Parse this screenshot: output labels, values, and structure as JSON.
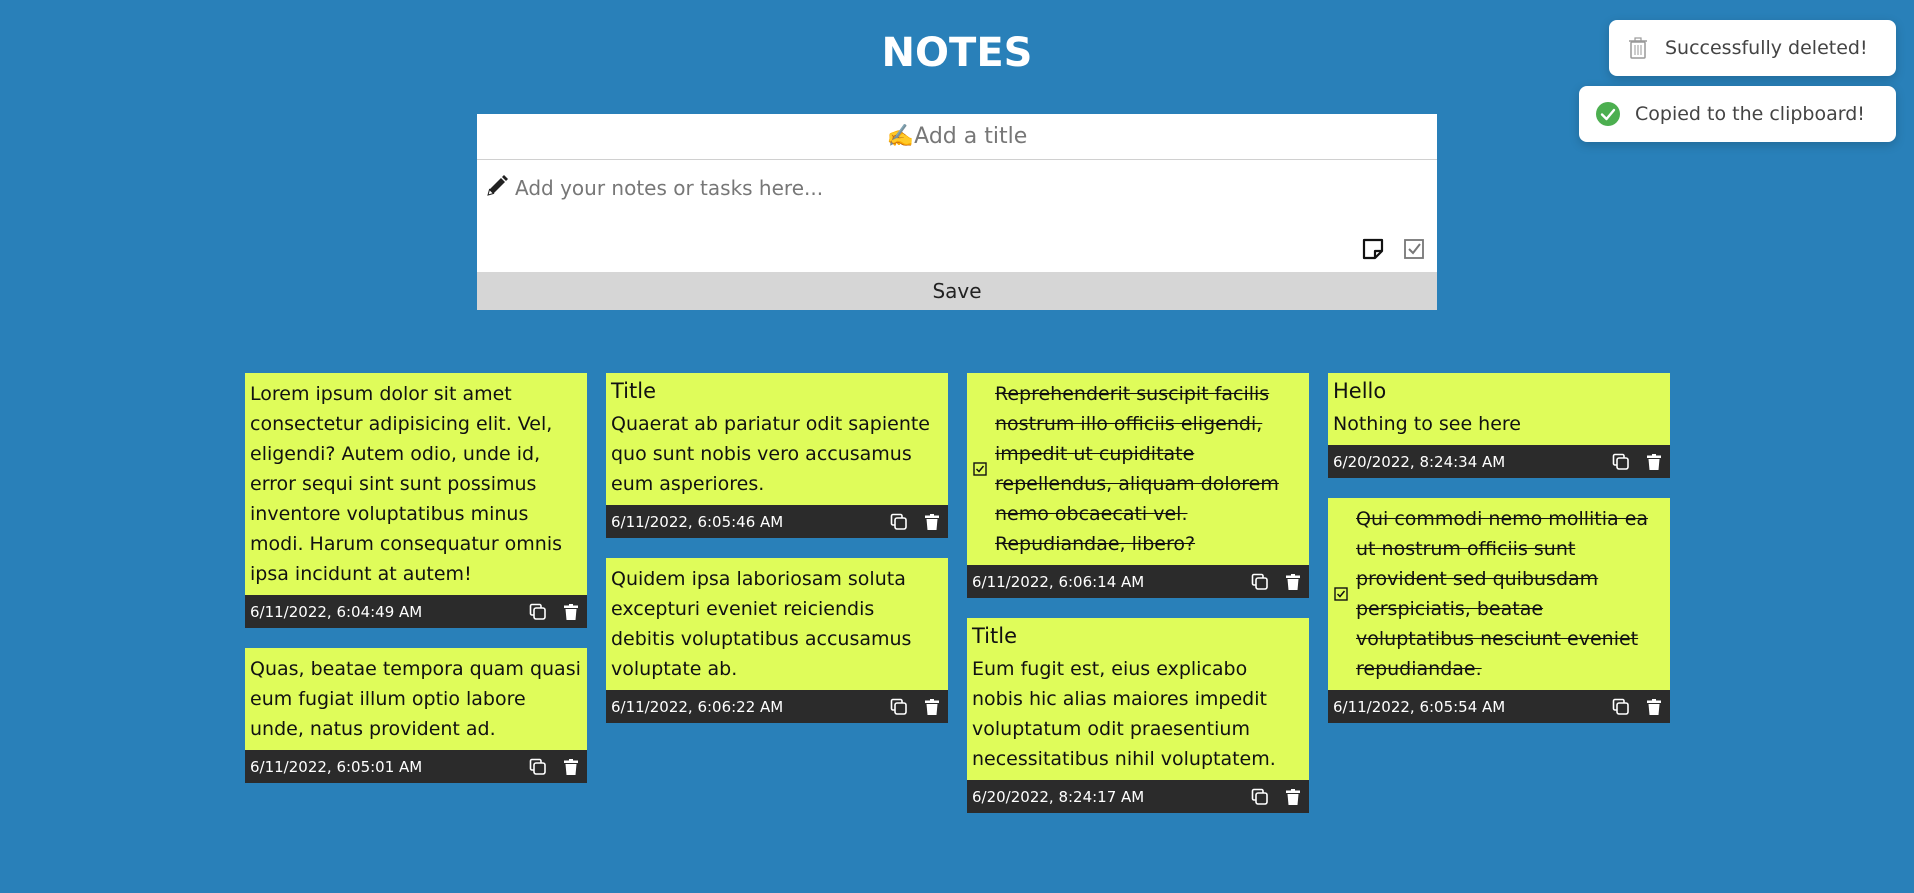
{
  "header": {
    "title": "NOTES"
  },
  "editor": {
    "title_placeholder": "✍️Add a title",
    "note_placeholder": "Add your notes or tasks here...",
    "save_label": "Save"
  },
  "notes": {
    "c1n1": {
      "text": "Lorem ipsum dolor sit amet consectetur adipisicing elit. Vel, eligendi? Autem odio, unde id, error sequi sint sunt possimus inventore voluptatibus minus modi. Harum consequatur omnis ipsa incidunt at autem!",
      "date": "6/11/2022, 6:04:49 AM"
    },
    "c1n2": {
      "text": "Quas, beatae tempora quam quasi eum fugiat illum optio labore unde, natus provident ad.",
      "date": "6/11/2022, 6:05:01 AM"
    },
    "c2n1": {
      "title": "Title",
      "text": "Quaerat ab pariatur odit sapiente quo sunt nobis vero accusamus eum asperiores.",
      "date": "6/11/2022, 6:05:46 AM"
    },
    "c2n2": {
      "text": "Quidem ipsa laboriosam soluta excepturi eveniet reiciendis debitis voluptatibus accusamus voluptate ab.",
      "date": "6/11/2022, 6:06:22 AM"
    },
    "c3n1": {
      "task": "Reprehenderit suscipit facilis nostrum illo officiis eligendi, impedit ut cupiditate repellendus, aliquam dolorem nemo obcaecati vel. Repudiandae, libero?",
      "date": "6/11/2022, 6:06:14 AM"
    },
    "c3n2": {
      "title": "Title",
      "text": "Eum fugit est, eius explicabo nobis hic alias maiores impedit voluptatum odit praesentium necessitatibus nihil voluptatem.",
      "date": "6/20/2022, 8:24:17 AM"
    },
    "c4n1": {
      "title": "Hello",
      "text": "Nothing to see here",
      "date": "6/20/2022, 8:24:34 AM"
    },
    "c4n2": {
      "task": "Qui commodi nemo mollitia ea ut nostrum officiis sunt provident sed quibusdam perspiciatis, beatae voluptatibus nesciunt eveniet repudiandae.",
      "date": "6/11/2022, 6:05:54 AM"
    }
  },
  "toasts": {
    "deleted": {
      "text": "Successfully deleted!",
      "icon": "trash-icon"
    },
    "copied": {
      "text": "Copied to the clipboard!",
      "icon": "check-circle-icon",
      "color": "#4caf50"
    }
  },
  "colors": {
    "background": "#2980b9",
    "note": "#dffc5a",
    "footer": "#2b2b2b"
  }
}
